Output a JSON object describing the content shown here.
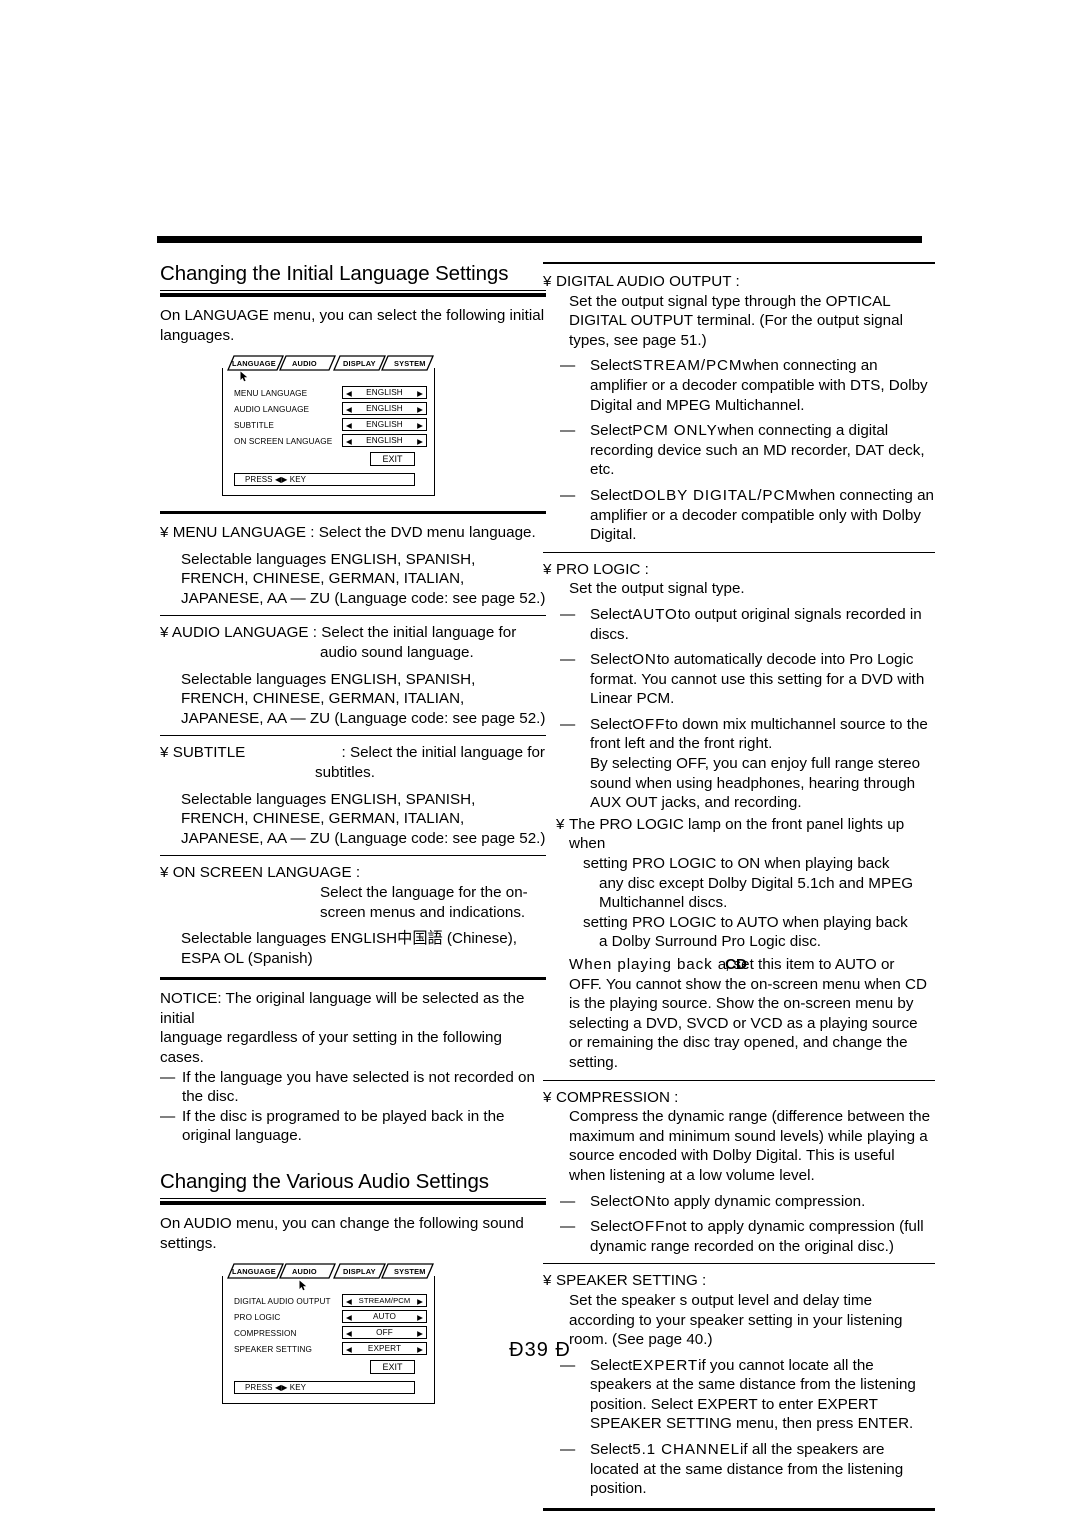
{
  "page": {
    "number_text": "Ð39 Ð"
  },
  "left": {
    "section1": {
      "heading": "Changing the Initial Language Settings",
      "intro": "On LANGUAGE menu, you can select the following initial languages.",
      "osd": {
        "tabs": [
          "LANGUAGE",
          "AUDIO",
          "DISPLAY",
          "SYSTEM"
        ],
        "active_tab": "LANGUAGE",
        "rows": [
          {
            "label": "MENU LANGUAGE",
            "value": "ENGLISH"
          },
          {
            "label": "AUDIO LANGUAGE",
            "value": "ENGLISH"
          },
          {
            "label": "SUBTITLE",
            "value": "ENGLISH"
          },
          {
            "label": "ON SCREEN LANGUAGE",
            "value": "ENGLISH"
          }
        ],
        "exit_label": "EXIT",
        "hint": "PRESS ◀▶ KEY"
      },
      "entries": [
        {
          "bullet": "¥",
          "term": "MENU LANGUAGE",
          "def": ": Select the DVD menu language.",
          "selectable": "Selectable languages ENGLISH, SPANISH, FRENCH, CHINESE, GERMAN, ITALIAN, JAPANESE, AA — ZU (Language code: see page 52.)"
        },
        {
          "bullet": "¥",
          "term": "AUDIO LANGUAGE",
          "def": ": Select the initial language for",
          "def2": "audio sound language.",
          "selectable": "Selectable languages ENGLISH, SPANISH, FRENCH, CHINESE, GERMAN, ITALIAN, JAPANESE, AA — ZU (Language code: see page 52.)"
        },
        {
          "bullet": "¥",
          "term": "SUBTITLE",
          "def": ": Select the initial language for",
          "def2": "subtitles.",
          "selectable": "Selectable languages ENGLISH, SPANISH, FRENCH, CHINESE, GERMAN, ITALIAN, JAPANESE, AA — ZU (Language code: see page 52.)"
        },
        {
          "bullet": "¥",
          "term": "ON SCREEN LANGUAGE :",
          "def": "Select the language for the on-",
          "def2": "screen menus and indications.",
          "selectable_a": "Selectable languages ENGLISH",
          "selectable_cjk": "中国語",
          "selectable_b": " (Chinese),",
          "selectable_c": "ESPA OL (Spanish)"
        }
      ],
      "notice": {
        "line1": "NOTICE: The original language will be selected as the initial",
        "line2": "language regardless of your setting in the following cases.",
        "items": [
          {
            "mark": "—",
            "text": "If the language you have selected is not recorded on the disc."
          },
          {
            "mark": "—",
            "text": "If the disc is programed to be played back in the original language."
          }
        ]
      }
    },
    "section2": {
      "heading": "Changing the Various Audio Settings",
      "intro": "On AUDIO menu, you can change the following sound settings.",
      "osd": {
        "tabs": [
          "LANGUAGE",
          "AUDIO",
          "DISPLAY",
          "SYSTEM"
        ],
        "active_tab": "AUDIO",
        "rows": [
          {
            "label": "DIGITAL AUDIO OUTPUT",
            "value": "STREAM/PCM"
          },
          {
            "label": "PRO LOGIC",
            "value": "AUTO"
          },
          {
            "label": "COMPRESSION",
            "value": "OFF"
          },
          {
            "label": "SPEAKER SETTING",
            "value": "EXPERT"
          }
        ],
        "exit_label": "EXIT",
        "hint": "PRESS ◀▶ KEY"
      }
    }
  },
  "right": {
    "digital_audio_output": {
      "bullet": "¥",
      "term": "DIGITAL AUDIO OUTPUT :",
      "desc": "Set the output signal type through the OPTICAL DIGITAL OUTPUT terminal. (For the output signal types, see page 51.)",
      "bullets": [
        {
          "mark": "—",
          "pre": "Select",
          "key": "STREAM/PCM",
          "post": "when connecting an amplifier or a decoder compatible with DTS, Dolby Digital and MPEG Multichannel."
        },
        {
          "mark": "—",
          "pre": "Select",
          "key": "PCM ONLY",
          "post": "when connecting a digital recording device such an MD recorder, DAT deck, etc."
        },
        {
          "mark": "—",
          "pre": "Select",
          "key": "DOLBY DIGITAL/PCM",
          "post": "when connecting an amplifier or a decoder compatible only with Dolby Digital."
        }
      ]
    },
    "pro_logic": {
      "bullet": "¥",
      "term": "PRO LOGIC :",
      "desc": "Set the output signal type.",
      "bullets": [
        {
          "mark": "—",
          "pre": "Select",
          "key": "AUTO",
          "post": "to output original signals recorded in discs."
        },
        {
          "mark": "—",
          "pre": "Select",
          "key": "ON",
          "post": "to automatically decode into Pro Logic format. You cannot use this setting for a DVD with Linear PCM."
        },
        {
          "mark": "—",
          "pre": "Select",
          "key": "OFF",
          "post": "to down mix multichannel source to the front left and the front right.",
          "extra": "By selecting  OFF,  you can enjoy full range stereo sound when using headphones, hearing through AUX OUT jacks, and recording."
        }
      ],
      "lamp_note": {
        "bullet": "¥",
        "line1": "The PRO LOGIC lamp on the front panel lights up",
        "line2": "when",
        "case1a": "setting  PRO LOGIC  to  ON  when playing back",
        "case1b": "any disc except Dolby Digital 5.1ch and MPEG Multichannel discs.",
        "case2a": "setting  PRO LOGIC  to  AUTO  when playing back",
        "case2b": "a Dolby Surround Pro Logic disc."
      },
      "cd_note": {
        "lead": "When playing back a",
        "overlap": "CD",
        "tail": ", set this item to  AUTO  or",
        "rest": "OFF. You cannot show the on-screen menu when CD is the playing source. Show the on-screen menu by selecting a DVD, SVCD or VCD as a playing source or remaining the disc tray opened, and change the setting."
      }
    },
    "compression": {
      "bullet": "¥",
      "term": "COMPRESSION :",
      "desc": "Compress the dynamic range (difference between the maximum and minimum sound levels) while playing a source encoded with Dolby Digital. This is useful when listening at a low volume level.",
      "bullets": [
        {
          "mark": "—",
          "pre": "Select",
          "key": "ON",
          "post": "to apply dynamic compression."
        },
        {
          "mark": "—",
          "pre": "Select",
          "key": "OFF",
          "post": "not to apply dynamic compression (full dynamic range recorded on the original disc.)"
        }
      ]
    },
    "speaker_setting": {
      "bullet": "¥",
      "term": "SPEAKER SETTING :",
      "desc": "Set the speaker s output level and delay time according to your speaker setting in your listening room. (See page 40.)",
      "bullets": [
        {
          "mark": "—",
          "pre": "Select",
          "key": "EXPERT",
          "post": "if you cannot locate all the speakers at the same distance from the listening position. Select  EXPERT  to enter EXPERT SPEAKER SETTING menu, then press ENTER."
        },
        {
          "mark": "—",
          "pre": "Select",
          "key": "5.1 CHANNEL",
          "post": "if all the speakers are located at the same distance from the listening position."
        }
      ]
    }
  }
}
